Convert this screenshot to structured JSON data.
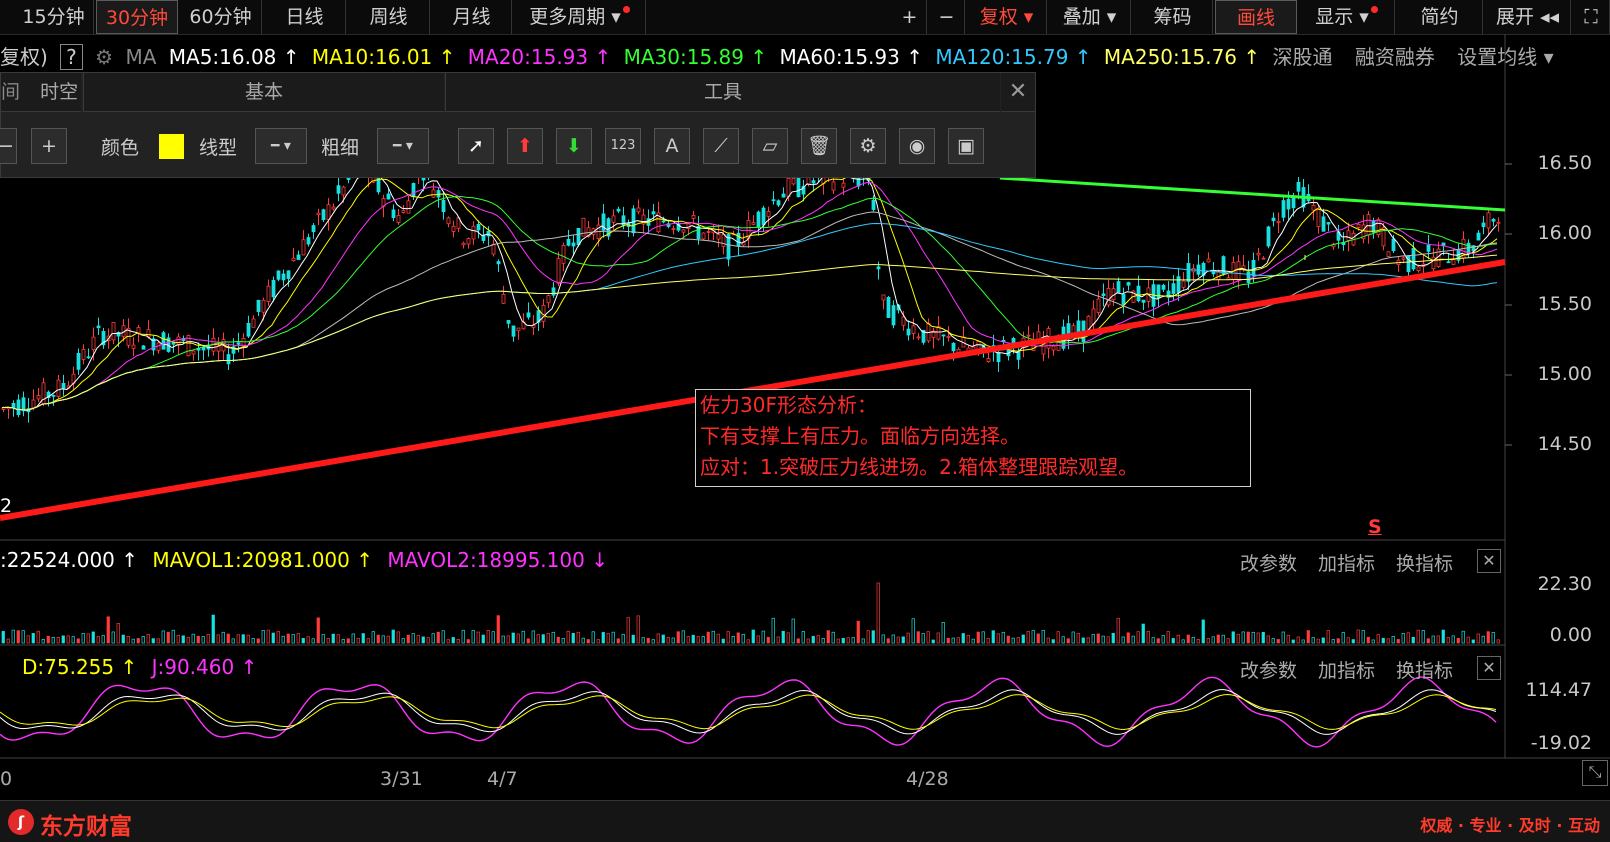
{
  "toolbar": {
    "periods": [
      "15分钟",
      "30分钟",
      "60分钟",
      "日线",
      "周线",
      "月线",
      "更多周期 ▾"
    ],
    "active_period": "30分钟",
    "right_buttons": [
      "+",
      "−",
      "复权 ▾",
      "叠加 ▾",
      "筹码",
      "画线",
      "显示 ▾",
      "简约",
      "展开 ◂◂",
      "⛶"
    ]
  },
  "ma_row": {
    "prefix": "复权)",
    "help": "?",
    "ma_label": "MA",
    "ma5": "MA5:16.08 ↑",
    "ma10": "MA10:16.01 ↑",
    "ma20": "MA20:15.93 ↑",
    "ma30": "MA30:15.89 ↑",
    "ma60": "MA60:15.93 ↑",
    "ma120": "MA120:15.79 ↑",
    "ma250": "MA250:15.76 ↑",
    "link1": "深股通",
    "link2": "融资融券",
    "link3": "设置均线 ▾"
  },
  "draw_toolbar": {
    "tab_left": "时空",
    "tab_left_prefix": "间",
    "section_basic": "基本",
    "section_tools": "工具",
    "color_label": "颜色",
    "line_label": "线型",
    "width_label": "粗细",
    "color_value": "#ffff00"
  },
  "price_axis": [
    "16.50",
    "16.00",
    "15.50",
    "15.00",
    "14.50"
  ],
  "annotation": {
    "line1": "佐力30F形态分析：",
    "line2": "下有支撑上有压力。面临方向选择。",
    "line3": "应对：1.突破压力线进场。2.箱体整理跟踪观望。"
  },
  "small_marker": "2",
  "s_marker": "S",
  "volume_panel": {
    "vol": ":22524.000 ↑",
    "mavol1": "MAVOL1:20981.000 ↑",
    "mavol2": "MAVOL2:18995.100 ↓",
    "axis": [
      "22.30",
      "0.00"
    ]
  },
  "kdj_panel": {
    "d": "D:75.255 ↑",
    "j": "J:90.460 ↑",
    "axis": [
      "114.47",
      "-19.02"
    ]
  },
  "panel_links": [
    "改参数",
    "加指标",
    "换指标"
  ],
  "close_x": "✕",
  "x_axis": [
    "0",
    "3/31",
    "4/7",
    "4/28"
  ],
  "bottom_bar": {
    "brand": "东方财富",
    "slogan": "权威 · 专业 · 及时 · 互动"
  },
  "colors": {
    "up": "#ff3b3b",
    "down": "#18e0e0",
    "ma5": "#ffffff",
    "ma10": "#ffff00",
    "ma20": "#ff33ff",
    "ma30": "#33ff33",
    "ma60": "#ffffff",
    "ma120": "#33c8ff",
    "ma250": "#ffff66",
    "support_line": "#ff1a1a",
    "resistance_line": "#33ff33"
  }
}
